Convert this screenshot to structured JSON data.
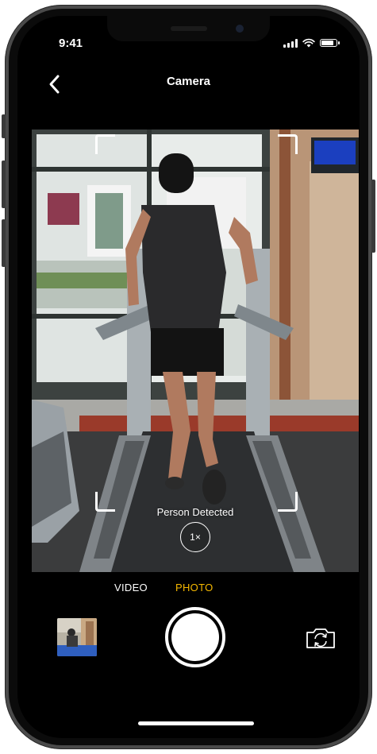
{
  "status_bar": {
    "time": "9:41",
    "signal_icon": "cellular-signal-icon",
    "wifi_icon": "wifi-icon",
    "battery_icon": "battery-icon",
    "battery_level": 0.9
  },
  "nav": {
    "title": "Camera",
    "back_icon": "chevron-left-icon"
  },
  "viewfinder": {
    "detection_label": "Person Detected",
    "zoom_label": "1×"
  },
  "modes": {
    "video": "VIDEO",
    "photo": "PHOTO",
    "active": "PHOTO"
  },
  "controls": {
    "thumbnail_icon": "last-photo-thumbnail",
    "shutter_icon": "shutter-button",
    "flip_icon": "camera-flip-icon"
  },
  "colors": {
    "accent": "#f5b800",
    "background": "#000000",
    "text": "#ffffff"
  }
}
